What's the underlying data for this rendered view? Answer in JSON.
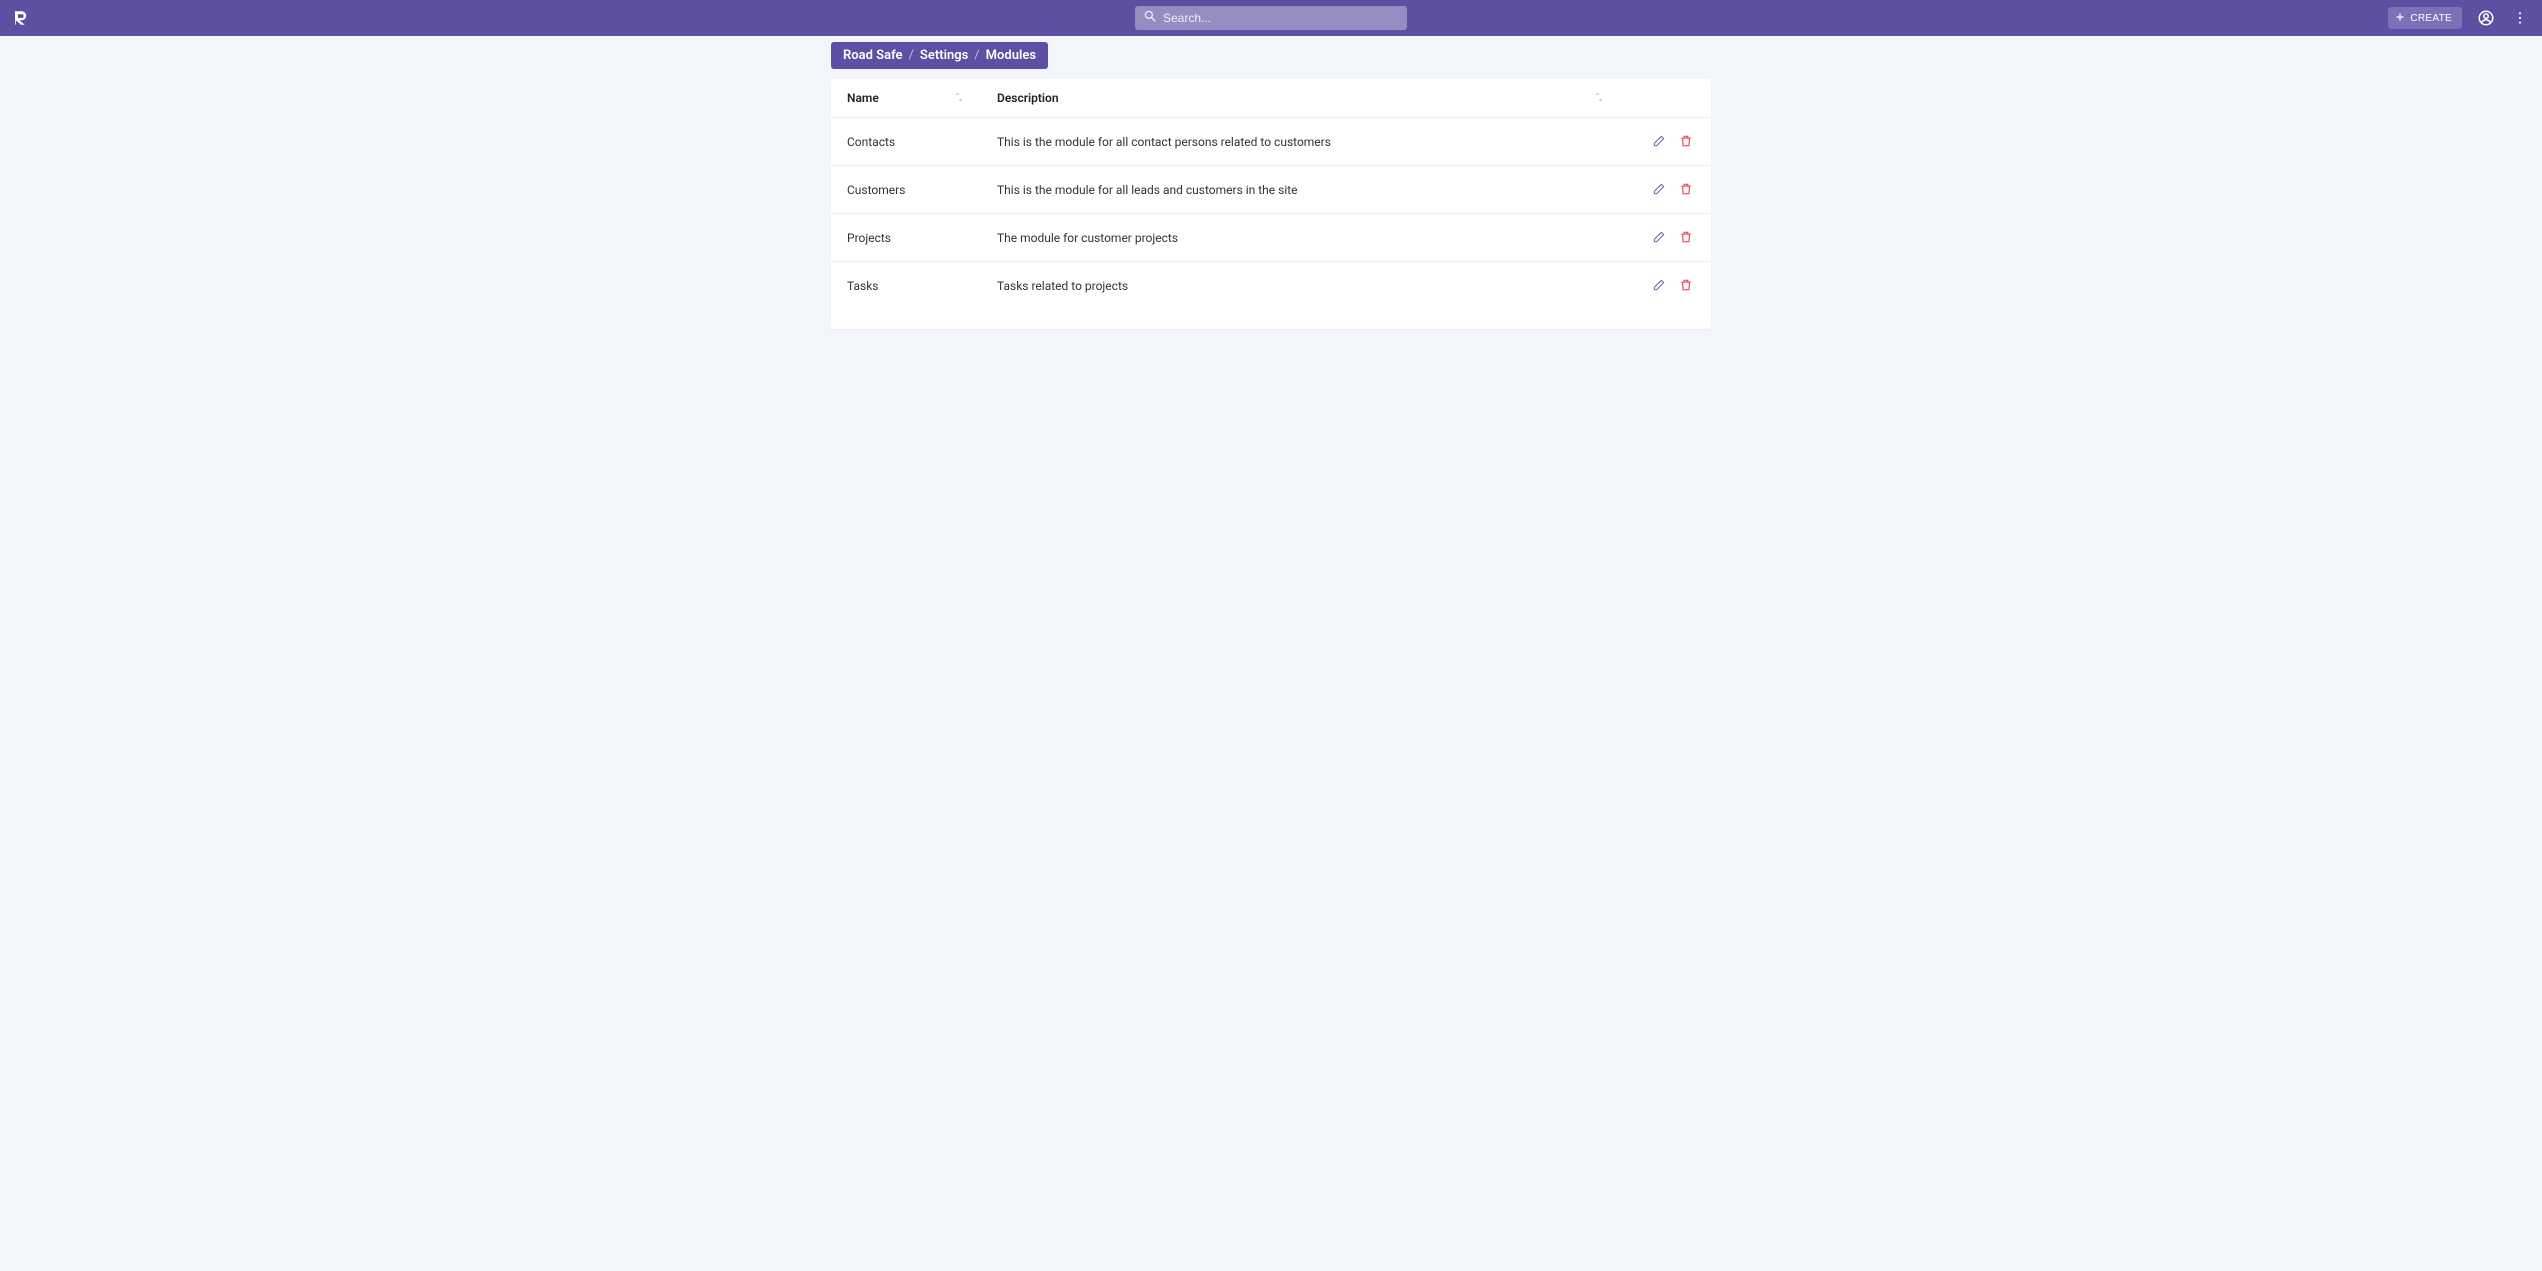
{
  "header": {
    "search_placeholder": "Search...",
    "create_label": "CREATE"
  },
  "breadcrumb": {
    "items": [
      "Road Safe",
      "Settings",
      "Modules"
    ],
    "separator": "/"
  },
  "table": {
    "columns": {
      "name": "Name",
      "description": "Description"
    },
    "rows": [
      {
        "name": "Contacts",
        "description": "This is the module for all contact persons related to customers"
      },
      {
        "name": "Customers",
        "description": "This is the module for all leads and customers in the site"
      },
      {
        "name": "Projects",
        "description": "The module for customer projects"
      },
      {
        "name": "Tasks",
        "description": "Tasks related to projects"
      }
    ]
  }
}
